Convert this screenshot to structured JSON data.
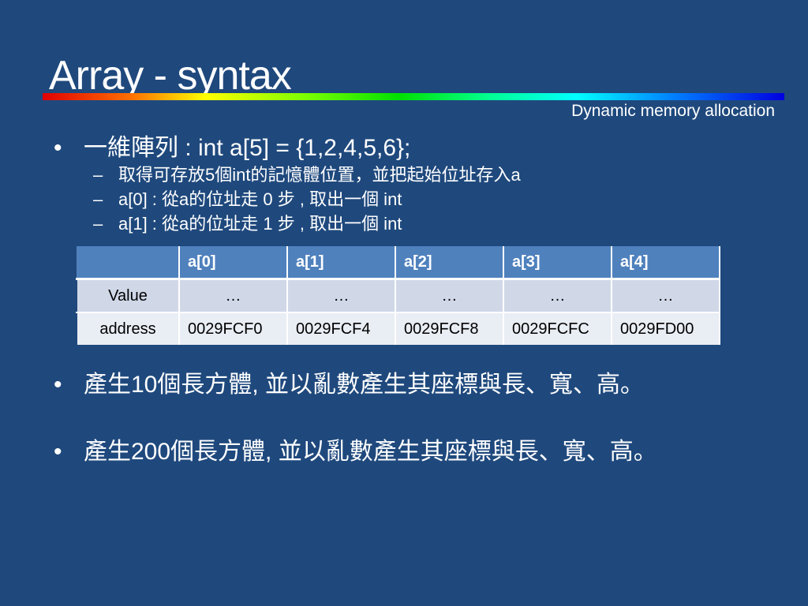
{
  "title": "Array - syntax",
  "subtitle": "Dynamic memory allocation",
  "bullet_char": "•",
  "dash_char": "–",
  "bullets": [
    {
      "text": "一維陣列  : int a[5] = {1,2,4,5,6};",
      "subitems": [
        "取得可存放5個int的記憶體位置，並把起始位址存入a",
        "a[0] : 從a的位址走 0 步 , 取出一個 int",
        "a[1] : 從a的位址走 1 步 , 取出一個 int"
      ]
    },
    {
      "text": "產生10個長方體, 並以亂數產生其座標與長、寬、高。"
    },
    {
      "text": "產生200個長方體, 並以亂數產生其座標與長、寬、高。"
    }
  ],
  "table": {
    "headers": [
      "",
      "a[0]",
      "a[1]",
      "a[2]",
      "a[3]",
      "a[4]"
    ],
    "rows": [
      [
        "Value",
        "…",
        "…",
        "…",
        "…",
        "…"
      ],
      [
        "address",
        "0029FCF0",
        "0029FCF4",
        "0029FCF8",
        "0029FCFC",
        "0029FD00"
      ]
    ]
  },
  "colors": {
    "background": "#1f497d",
    "header": "#4f81bd",
    "row1": "#d0d8e8",
    "row2": "#e9edf4"
  }
}
